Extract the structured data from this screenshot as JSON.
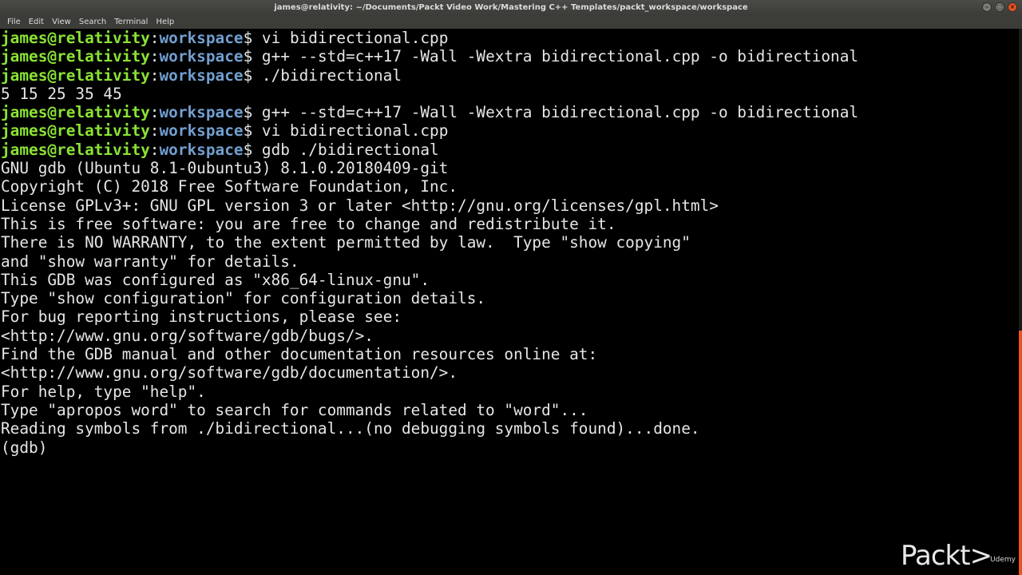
{
  "window": {
    "title": "james@relativity: ~/Documents/Packt Video Work/Mastering C++ Templates/packt_workspace/workspace"
  },
  "menubar": {
    "items": [
      "File",
      "Edit",
      "View",
      "Search",
      "Terminal",
      "Help"
    ]
  },
  "terminal": {
    "prompt": {
      "user": "james@relativity",
      "sep": ":",
      "dir": "workspace",
      "symbol": "$ "
    },
    "lines": [
      {
        "type": "cmd",
        "text": "vi bidirectional.cpp"
      },
      {
        "type": "cmd",
        "text": "g++ --std=c++17 -Wall -Wextra bidirectional.cpp -o bidirectional"
      },
      {
        "type": "cmd",
        "text": "./bidirectional"
      },
      {
        "type": "out",
        "text": "5 15 25 35 45"
      },
      {
        "type": "cmd",
        "text": "g++ --std=c++17 -Wall -Wextra bidirectional.cpp -o bidirectional"
      },
      {
        "type": "cmd",
        "text": "vi bidirectional.cpp"
      },
      {
        "type": "cmd",
        "text": "gdb ./bidirectional"
      },
      {
        "type": "out",
        "text": "GNU gdb (Ubuntu 8.1-0ubuntu3) 8.1.0.20180409-git"
      },
      {
        "type": "out",
        "text": "Copyright (C) 2018 Free Software Foundation, Inc."
      },
      {
        "type": "out",
        "text": "License GPLv3+: GNU GPL version 3 or later <http://gnu.org/licenses/gpl.html>"
      },
      {
        "type": "out",
        "text": "This is free software: you are free to change and redistribute it."
      },
      {
        "type": "out",
        "text": "There is NO WARRANTY, to the extent permitted by law.  Type \"show copying\""
      },
      {
        "type": "out",
        "text": "and \"show warranty\" for details."
      },
      {
        "type": "out",
        "text": "This GDB was configured as \"x86_64-linux-gnu\"."
      },
      {
        "type": "out",
        "text": "Type \"show configuration\" for configuration details."
      },
      {
        "type": "out",
        "text": "For bug reporting instructions, please see:"
      },
      {
        "type": "out",
        "text": "<http://www.gnu.org/software/gdb/bugs/>."
      },
      {
        "type": "out",
        "text": "Find the GDB manual and other documentation resources online at:"
      },
      {
        "type": "out",
        "text": "<http://www.gnu.org/software/gdb/documentation/>."
      },
      {
        "type": "out",
        "text": "For help, type \"help\"."
      },
      {
        "type": "out",
        "text": "Type \"apropos word\" to search for commands related to \"word\"..."
      },
      {
        "type": "out",
        "text": "Reading symbols from ./bidirectional...(no debugging symbols found)...done."
      },
      {
        "type": "out",
        "text": "(gdb) "
      }
    ]
  },
  "watermark": {
    "packt": "Packt>",
    "udemy": "Udemy"
  },
  "colors": {
    "background": "#000000",
    "text": "#e6e6e6",
    "prompt_user": "#8ae234",
    "prompt_dir": "#729fcf",
    "scrollbar_accent": "#e95420"
  },
  "icons": {
    "minimize": "minimize-icon",
    "maximize": "maximize-icon",
    "close": "close-icon"
  }
}
